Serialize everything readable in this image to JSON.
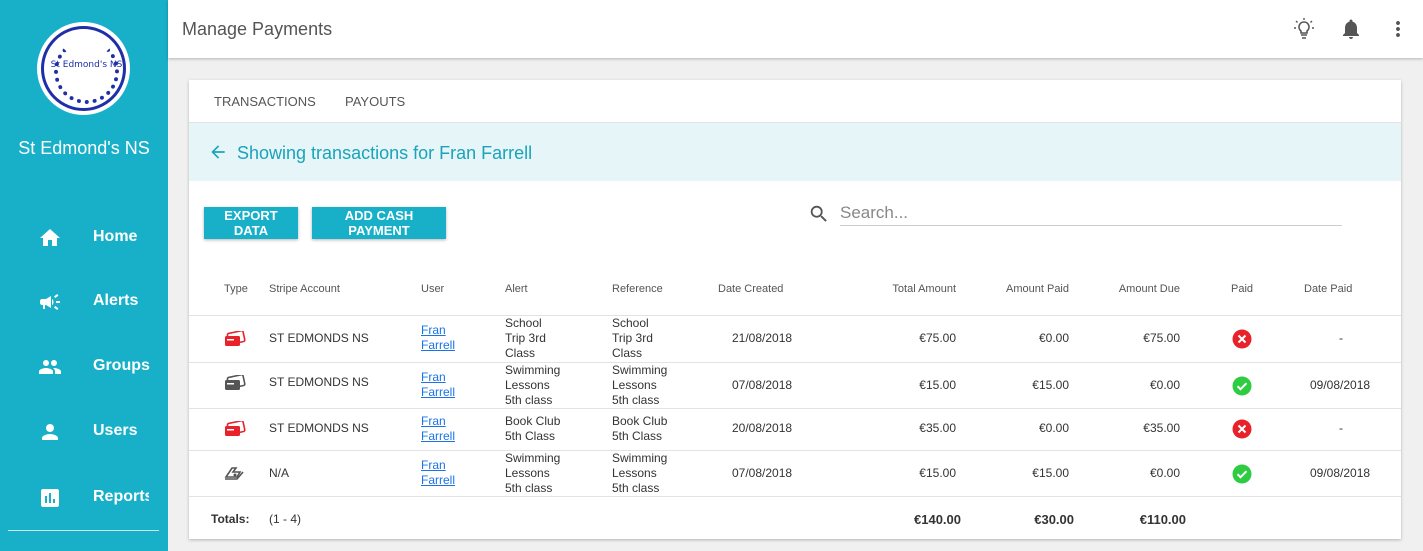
{
  "sidebar": {
    "logo_text": "St Edmond's NS",
    "school_name": "St Edmond's NS",
    "items": [
      {
        "label": "Home"
      },
      {
        "label": "Alerts"
      },
      {
        "label": "Groups"
      },
      {
        "label": "Users"
      },
      {
        "label": "Reports"
      }
    ]
  },
  "header": {
    "title": "Manage Payments",
    "icons": [
      "lightbulb-icon",
      "bell-icon",
      "more-vert-icon"
    ]
  },
  "tabs": [
    {
      "label": "TRANSACTIONS"
    },
    {
      "label": "PAYOUTS"
    }
  ],
  "banner": {
    "text": "Showing transactions for Fran Farrell"
  },
  "toolbar": {
    "export_label": "EXPORT DATA",
    "add_cash_label": "ADD CASH PAYMENT",
    "search_placeholder": "Search..."
  },
  "table": {
    "columns": [
      "Type",
      "Stripe Account",
      "User",
      "Alert",
      "Reference",
      "Date Created",
      "Total Amount",
      "Amount Paid",
      "Amount Due",
      "Paid",
      "Date Paid"
    ],
    "rows": [
      {
        "type": "card-unpaid",
        "stripe_account": "ST EDMONDS NS",
        "user": [
          "Fran",
          "Farrell"
        ],
        "alert": [
          "School",
          "Trip 3rd",
          "Class"
        ],
        "reference": [
          "School",
          "Trip 3rd",
          "Class"
        ],
        "date_created": "21/08/2018",
        "total": "€75.00",
        "paid_amount": "€0.00",
        "due": "€75.00",
        "paid": false,
        "date_paid": "-"
      },
      {
        "type": "card-paid",
        "stripe_account": "ST EDMONDS NS",
        "user": [
          "Fran",
          "Farrell"
        ],
        "alert": [
          "Swimming",
          "Lessons",
          "5th class"
        ],
        "reference": [
          "Swimming",
          "Lessons",
          "5th class"
        ],
        "date_created": "07/08/2018",
        "total": "€15.00",
        "paid_amount": "€15.00",
        "due": "€0.00",
        "paid": true,
        "date_paid": "09/08/2018"
      },
      {
        "type": "card-unpaid",
        "stripe_account": "ST EDMONDS NS",
        "user": [
          "Fran",
          "Farrell"
        ],
        "alert": [
          "Book Club",
          "5th Class"
        ],
        "reference": [
          "Book Club",
          "5th Class"
        ],
        "date_created": "20/08/2018",
        "total": "€35.00",
        "paid_amount": "€0.00",
        "due": "€35.00",
        "paid": false,
        "date_paid": "-"
      },
      {
        "type": "cash",
        "stripe_account": "N/A",
        "user": [
          "Fran",
          "Farrell"
        ],
        "alert": [
          "Swimming",
          "Lessons",
          "5th class"
        ],
        "reference": [
          "Swimming",
          "Lessons",
          "5th class"
        ],
        "date_created": "07/08/2018",
        "total": "€15.00",
        "paid_amount": "€15.00",
        "due": "€0.00",
        "paid": true,
        "date_paid": "09/08/2018"
      }
    ],
    "totals": {
      "label": "Totals:",
      "range": "(1 - 4)",
      "total": "€140.00",
      "paid_amount": "€30.00",
      "due": "€110.00"
    }
  },
  "colors": {
    "accent": "#17b0c8",
    "paid": "#2ecc40",
    "unpaid": "#e8222a"
  }
}
